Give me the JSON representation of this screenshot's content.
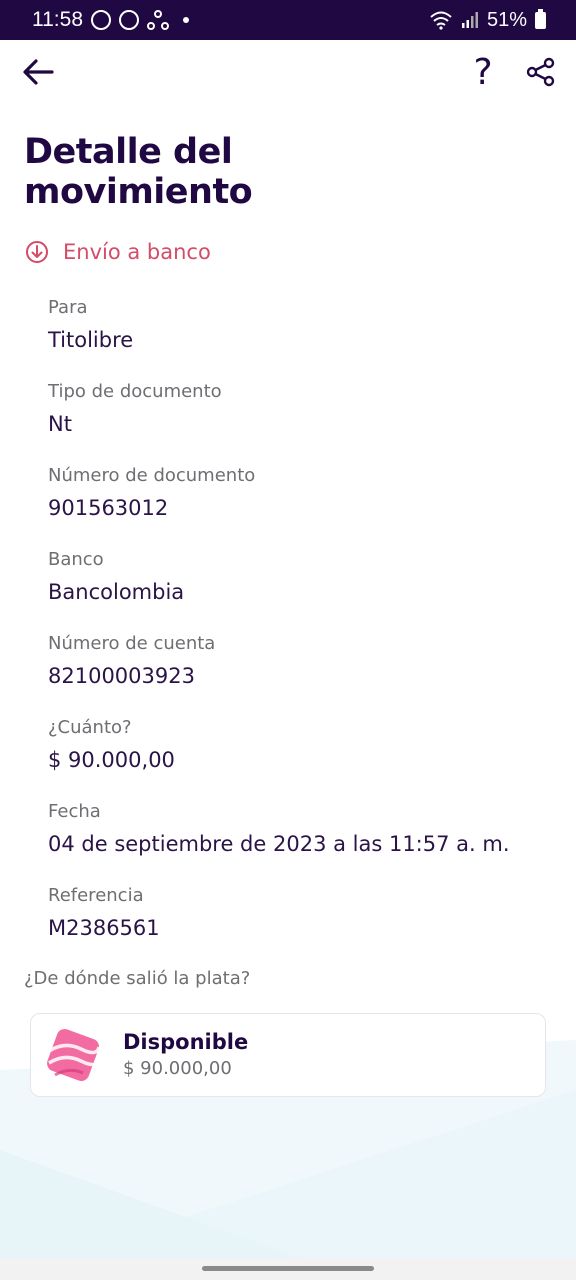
{
  "status_bar": {
    "time": "11:58",
    "battery": "51%",
    "icons": [
      "whatsapp-icon",
      "bot-icon",
      "share-app-icon",
      "wifi-icon",
      "signal-icon",
      "battery-icon"
    ]
  },
  "app_bar": {
    "back_icon": "arrow-left-icon",
    "help_label": "?",
    "share_icon": "share-icon"
  },
  "page": {
    "title": "Detalle del movimiento",
    "transaction_type": "Envío a banco",
    "transaction_type_color": "#d44c68",
    "title_color": "#200842"
  },
  "details": [
    {
      "label": "Para",
      "value": "Titolibre"
    },
    {
      "label": "Tipo de documento",
      "value": "Nt"
    },
    {
      "label": "Número de documento",
      "value": "901563012"
    },
    {
      "label": "Banco",
      "value": "Bancolombia"
    },
    {
      "label": "Número de cuenta",
      "value": "82100003923"
    },
    {
      "label": "¿Cuánto?",
      "value": "$ 90.000,00"
    },
    {
      "label": "Fecha",
      "value": "04 de septiembre de 2023 a las 11:57 a. m."
    },
    {
      "label": "Referencia",
      "value": "M2386561"
    }
  ],
  "source": {
    "question": "¿De dónde salió la plata?",
    "account_name": "Disponible",
    "account_amount": "$ 90.000,00"
  }
}
